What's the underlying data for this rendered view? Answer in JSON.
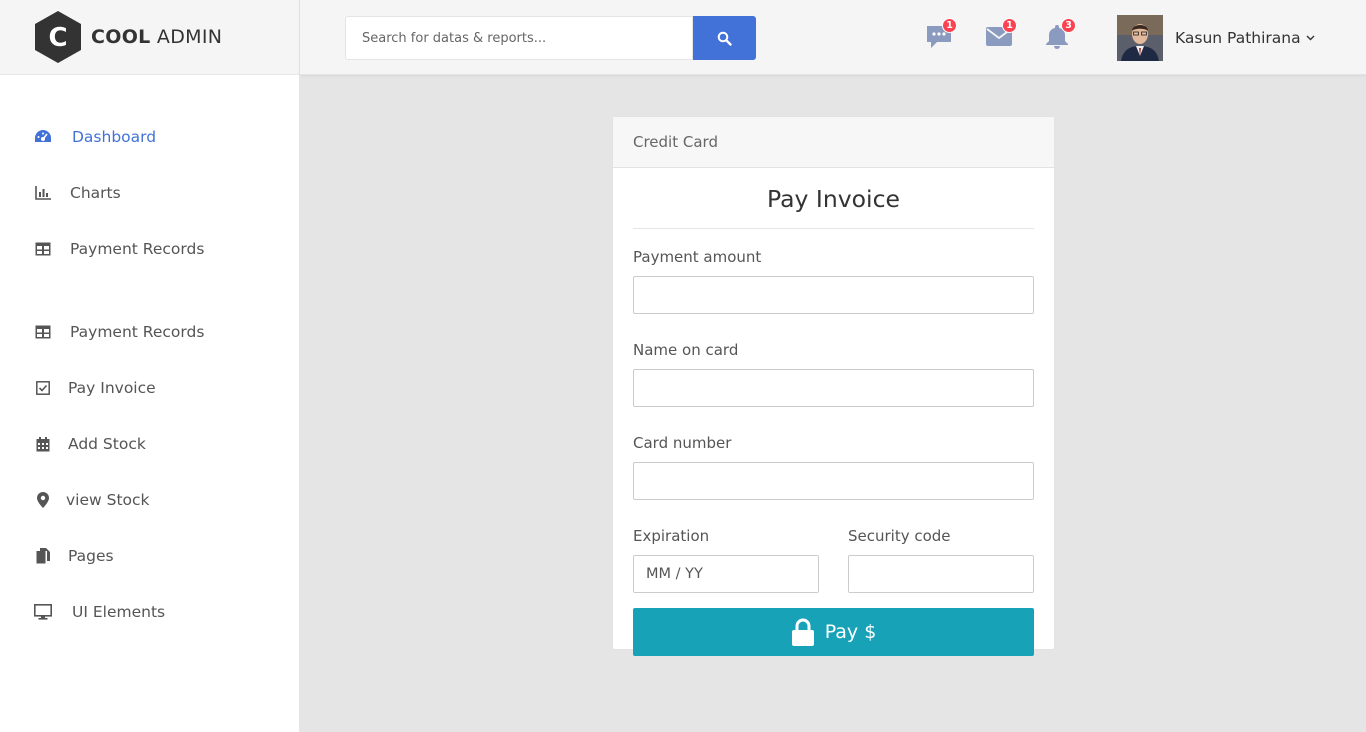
{
  "brand": {
    "bold": "COOL",
    "light": "ADMIN",
    "letter": "C",
    "colors": {
      "hex": "#333333"
    }
  },
  "search": {
    "placeholder": "Search for datas & reports..."
  },
  "header": {
    "messages_badge": "1",
    "mail_badge": "1",
    "notifications_badge": "3",
    "user_name": "Kasun Pathirana"
  },
  "sidebar": {
    "items": [
      {
        "label": "Dashboard",
        "icon": "dashboard-icon",
        "active": true
      },
      {
        "label": "Charts",
        "icon": "bar-chart-icon"
      },
      {
        "label": "Payment Records",
        "icon": "table-icon"
      },
      {
        "label": "Payment Records",
        "icon": "table-icon"
      },
      {
        "label": "Pay Invoice",
        "icon": "check-square-icon"
      },
      {
        "label": "Add Stock",
        "icon": "calendar-icon"
      },
      {
        "label": "view Stock",
        "icon": "map-marker-icon"
      },
      {
        "label": "Pages",
        "icon": "copy-icon"
      },
      {
        "label": "UI Elements",
        "icon": "desktop-icon"
      }
    ]
  },
  "card": {
    "header": "Credit Card",
    "title": "Pay Invoice",
    "amount_label": "Payment amount",
    "amount_value": "",
    "name_label": "Name on card",
    "name_value": "",
    "number_label": "Card number",
    "number_value": "",
    "expiration_label": "Expiration",
    "expiration_placeholder": "MM / YY",
    "security_label": "Security code",
    "security_value": "",
    "pay_label": "Pay $"
  },
  "colors": {
    "accent": "#4272d7",
    "pay_button": "#17a2b8",
    "badge": "#fa4251"
  }
}
